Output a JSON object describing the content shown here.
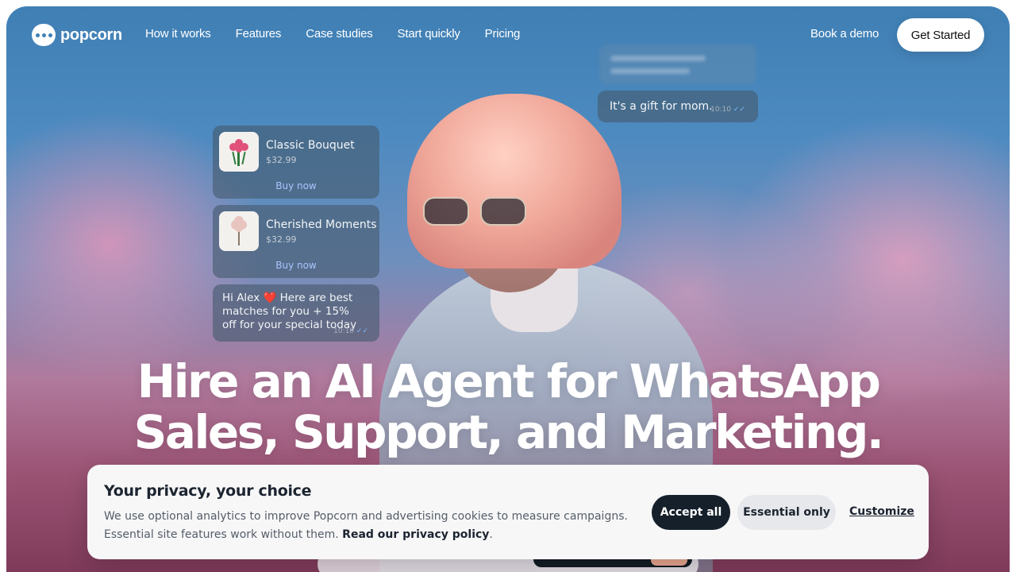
{
  "nav": {
    "logo_text": "popcorn",
    "links": [
      "How it works",
      "Features",
      "Case studies",
      "Start quickly",
      "Pricing"
    ],
    "book_demo": "Book a demo",
    "get_started": "Get Started"
  },
  "chat": {
    "products": [
      {
        "name": "Classic Bouquet",
        "price": "$32.99",
        "action": "Buy now",
        "thumb_icon": "bouquet-icon"
      },
      {
        "name": "Cherished Moments",
        "price": "$32.99",
        "action": "Buy now",
        "thumb_icon": "flower-icon"
      }
    ],
    "greeting": {
      "text": "Hi Alex ❤️ Here are best matches for you + 15% off for your special today",
      "time": "10:10"
    },
    "gift": {
      "text": "It's a gift for mom.",
      "time": "10:10"
    }
  },
  "headline": {
    "line1": "Hire an AI Agent for WhatsApp",
    "line2": "Sales, Support, and Marketing."
  },
  "cookie": {
    "title": "Your privacy, your choice",
    "body": "We use optional analytics to improve Popcorn and advertising cookies to measure campaigns. Essential site features work without them.",
    "policy_link": "Read our privacy policy",
    "accept": "Accept all",
    "essential": "Essential only",
    "customize": "Customize"
  },
  "colors": {
    "accent_dark": "#15202b",
    "sky": "#3f7fb4",
    "link_blue": "#a9c4ff"
  }
}
